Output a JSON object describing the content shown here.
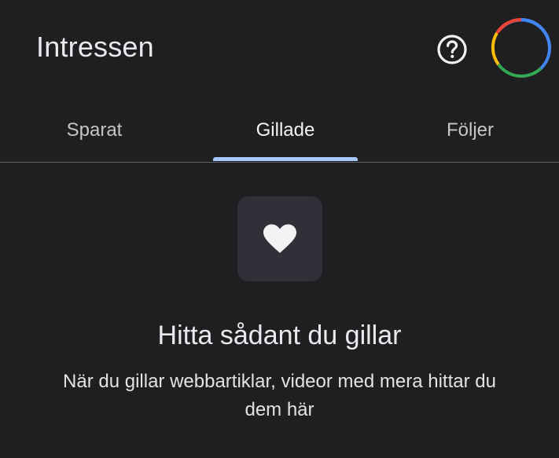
{
  "header": {
    "title": "Intressen",
    "help_icon": "help-circle-icon",
    "avatar_icon": "google-account-ring"
  },
  "tabs": [
    {
      "label": "Sparat",
      "selected": false
    },
    {
      "label": "Gillade",
      "selected": true
    },
    {
      "label": "Följer",
      "selected": false
    }
  ],
  "empty_state": {
    "icon": "heart-icon",
    "title": "Hitta sådant du gillar",
    "description": "När du gillar webbartiklar, videor med mera hittar du dem här"
  },
  "colors": {
    "background": "#1f1f21",
    "tab_indicator": "#a8c7fa",
    "icon_box": "#2f3038",
    "google_blue": "#4285f4",
    "google_red": "#ea4335",
    "google_yellow": "#fbbc04",
    "google_green": "#34a853"
  }
}
